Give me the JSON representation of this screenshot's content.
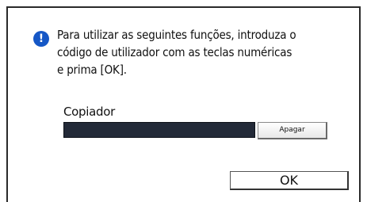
{
  "dialog": {
    "icon": "info-icon",
    "icon_glyph": "!",
    "icon_color": "#1557c6",
    "message_lines": [
      "Para utilizar as seguintes funções, introduza o",
      "código de utilizador com as teclas numéricas",
      "e prima [OK]."
    ]
  },
  "field": {
    "label": "Copiador",
    "value": "",
    "background_color": "#232a38",
    "clear_label": "Apagar"
  },
  "actions": {
    "ok_label": "OK"
  }
}
